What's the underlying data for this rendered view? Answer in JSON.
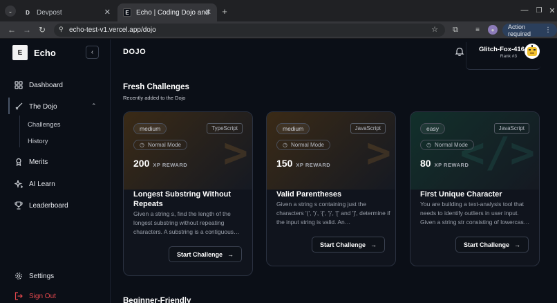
{
  "browser": {
    "tabs": [
      {
        "title": "Devpost",
        "favicon": "D"
      },
      {
        "title": "Echo | Coding Dojo and C",
        "favicon": "E"
      }
    ],
    "url": "echo-test-v1.vercel.app/dojo",
    "action_label": "Action required"
  },
  "app": {
    "brand": "Echo",
    "logo_glyph": "E",
    "page_title": "DOJO",
    "user": {
      "name": "Glitch-Fox-416",
      "rank": "Rank #3"
    }
  },
  "sidebar": {
    "items": [
      {
        "label": "Dashboard",
        "icon": "grid-icon"
      },
      {
        "label": "The Dojo",
        "icon": "sword-icon"
      },
      {
        "label": "Merits",
        "icon": "medal-icon"
      },
      {
        "label": "AI Learn",
        "icon": "sparkle-icon"
      },
      {
        "label": "Leaderboard",
        "icon": "trophy-icon"
      }
    ],
    "dojo_sub": [
      "Challenges",
      "History"
    ],
    "settings": "Settings",
    "signout": "Sign Out"
  },
  "section": {
    "title": "Fresh Challenges",
    "subtitle": "Recently added to the Dojo",
    "next_title": "Beginner-Friendly"
  },
  "cards": [
    {
      "difficulty": "medium",
      "language": "TypeScript",
      "mode": "Normal Mode",
      "xp": "200",
      "xp_label": "XP REWARD",
      "title": "Longest Substring Without Repeats",
      "desc": "Given a string s, find the length of the longest substring without repeating characters. A substring is a contiguous…",
      "button": "Start Challenge",
      "deco": ">",
      "color": "#3a2a16"
    },
    {
      "difficulty": "medium",
      "language": "JavaScript",
      "mode": "Normal Mode",
      "xp": "150",
      "xp_label": "XP REWARD",
      "title": "Valid Parentheses",
      "desc": "Given a string s containing just the characters '(', ')', '{', '}', '[' and ']', determine if the input string is valid. An…",
      "button": "Start Challenge",
      "deco": ">",
      "color": "#3a2a16"
    },
    {
      "difficulty": "easy",
      "language": "JavaScript",
      "mode": "Normal Mode",
      "xp": "80",
      "xp_label": "XP REWARD",
      "title": "First Unique Character",
      "desc": "You are building a text-analysis tool that needs to identify outliers in user input. Given a string str consisting of lowercas…",
      "button": "Start Challenge",
      "deco": "</>",
      "color": "#12302b"
    }
  ]
}
